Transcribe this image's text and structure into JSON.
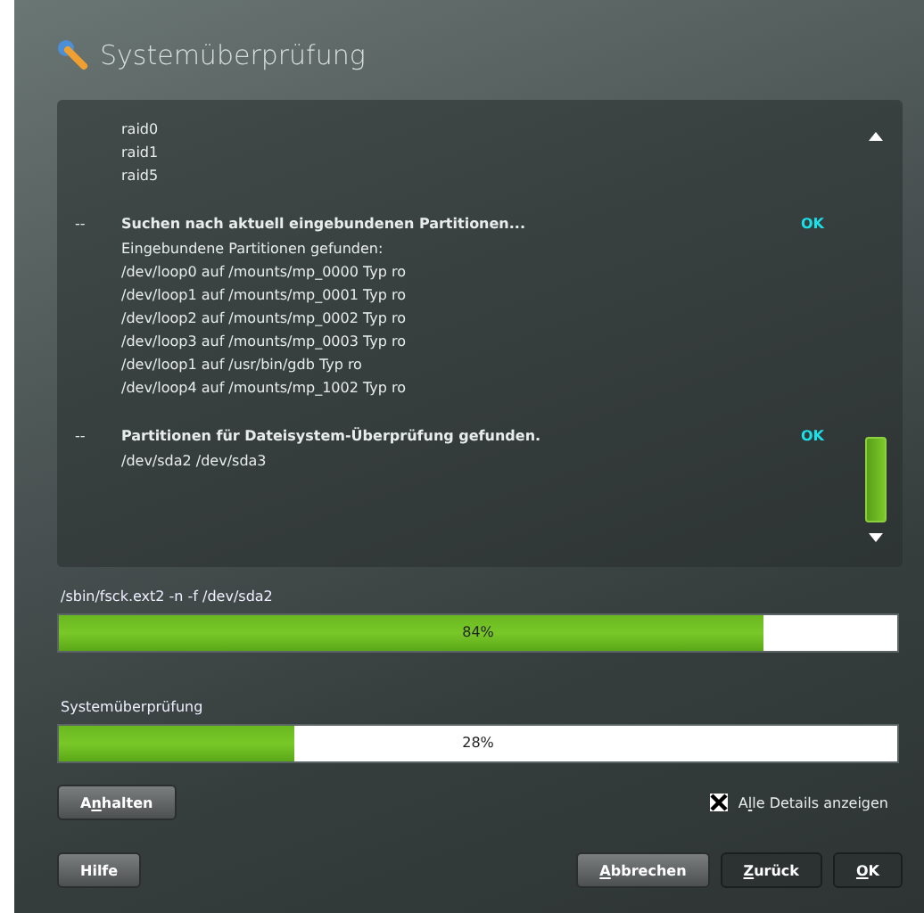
{
  "window": {
    "title": "Systemüberprüfung"
  },
  "log": [
    {
      "kind": "text",
      "text": "raid0"
    },
    {
      "kind": "text",
      "text": "raid1"
    },
    {
      "kind": "text",
      "text": "raid5"
    },
    {
      "kind": "step",
      "marker": "--",
      "title": "Suchen nach aktuell eingebundenen Partitionen...",
      "status": "OK",
      "lines": [
        "Eingebundene Partitionen gefunden:",
        "/dev/loop0 auf /mounts/mp_0000 Typ ro",
        "/dev/loop1 auf /mounts/mp_0001 Typ ro",
        "/dev/loop2 auf /mounts/mp_0002 Typ ro",
        "/dev/loop3 auf /mounts/mp_0003 Typ ro",
        "/dev/loop1 auf /usr/bin/gdb Typ ro",
        "/dev/loop4 auf /mounts/mp_1002 Typ ro"
      ]
    },
    {
      "kind": "step",
      "marker": "--",
      "title": "Partitionen für Dateisystem-Überprüfung gefunden.",
      "status": "OK",
      "lines": [
        "/dev/sda2 /dev/sda3"
      ]
    }
  ],
  "progress": [
    {
      "label": "/sbin/fsck.ext2 -n -f /dev/sda2",
      "level": 0.84,
      "reading": "84%"
    },
    {
      "label": "Systemüberprüfung",
      "level": 0.28,
      "reading": "28%"
    }
  ],
  "stop_button": {
    "pre": "A",
    "key": "n",
    "post": "halten"
  },
  "details_checkbox": {
    "pre": "A",
    "key": "l",
    "post": "le Details anzeigen",
    "checked": true
  },
  "buttons": [
    {
      "post": "Hilfe",
      "kind": "help"
    },
    {
      "key": "A",
      "post": "bbrechen",
      "kind": "raised"
    },
    {
      "key": "Z",
      "post": "urück",
      "kind": "flat"
    },
    {
      "key": "O",
      "post": "K",
      "kind": "flat"
    }
  ]
}
